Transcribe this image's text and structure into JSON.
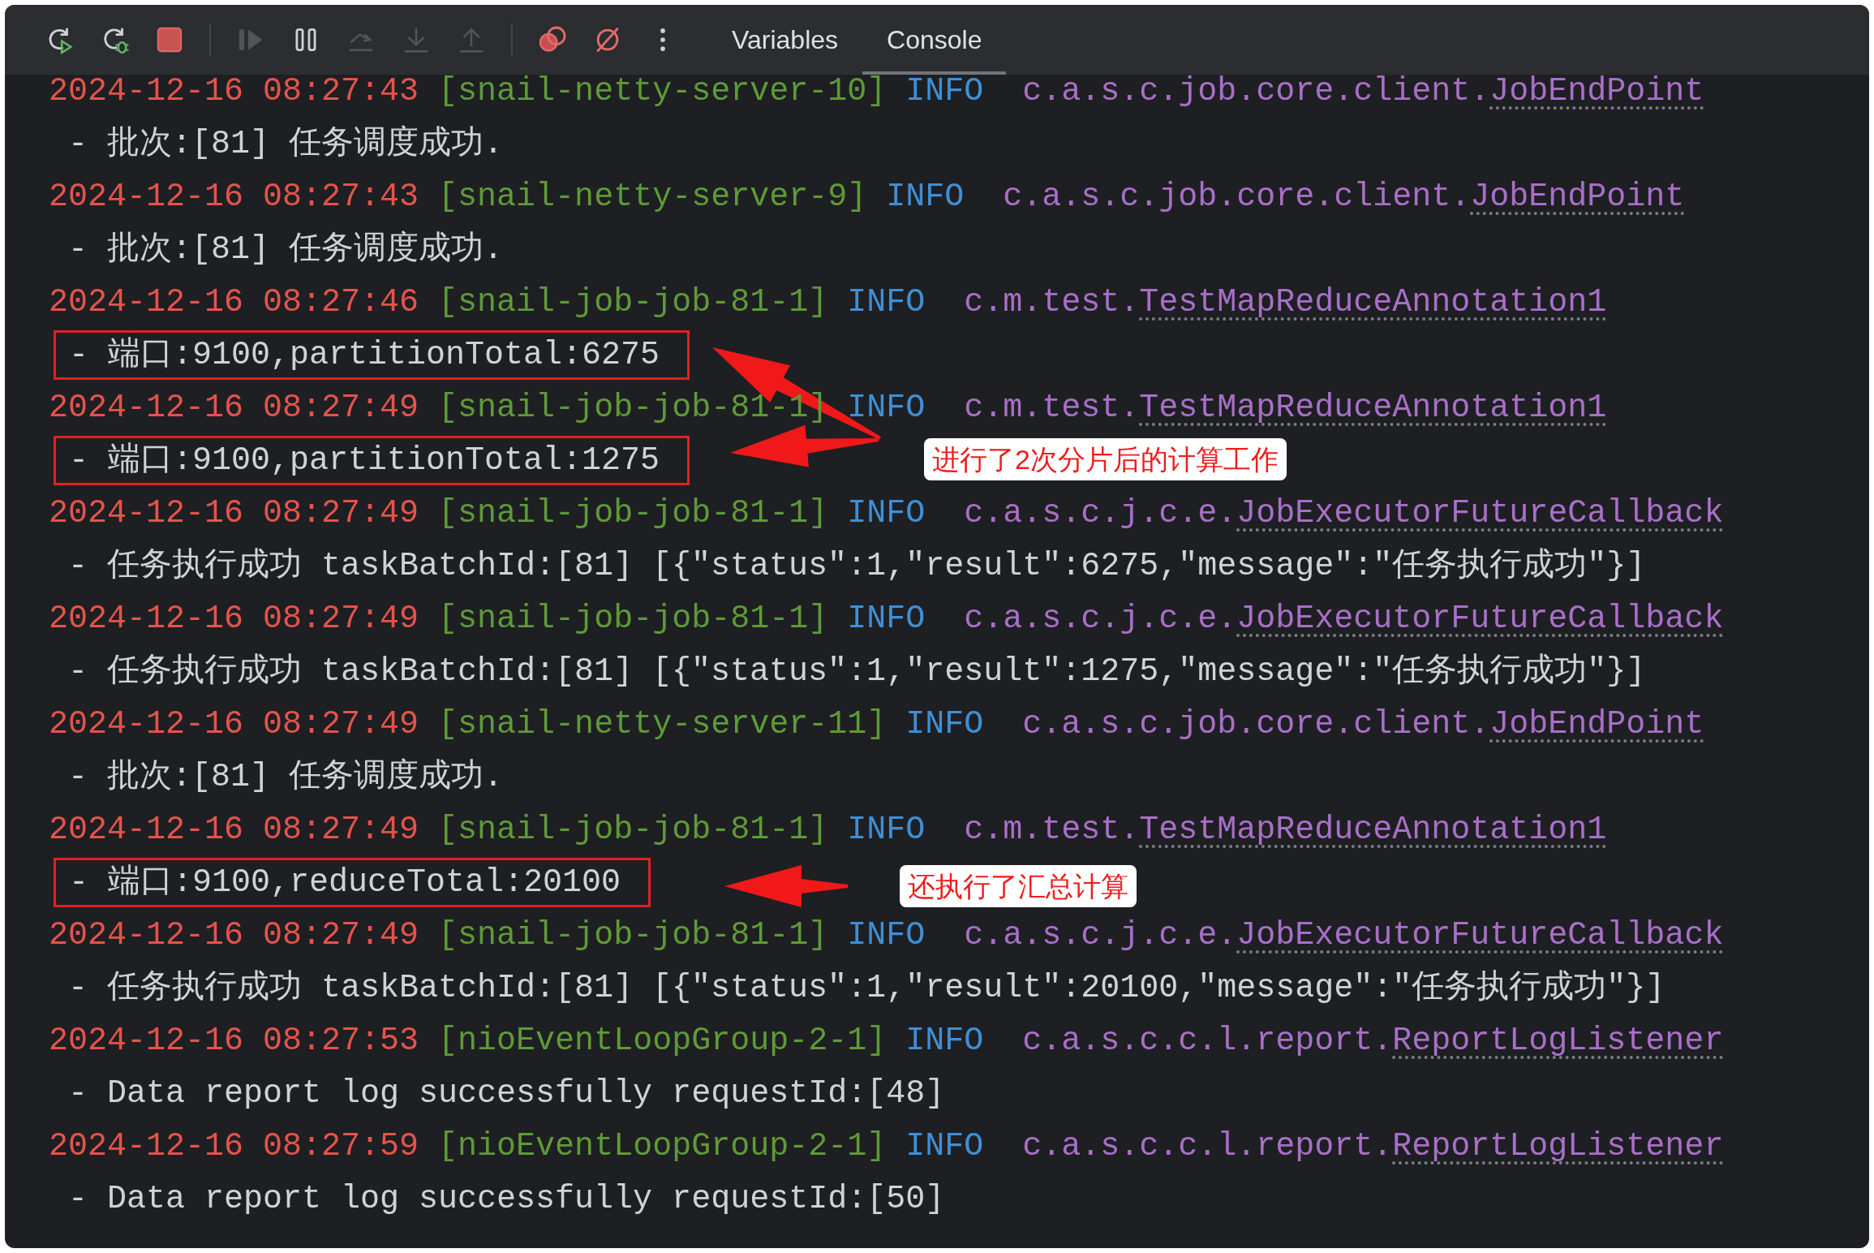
{
  "toolbar": {
    "buttons": [
      {
        "kind": "rerun",
        "disabled": false
      },
      {
        "kind": "rerun-debug",
        "disabled": false
      },
      {
        "kind": "stop",
        "disabled": false
      },
      {
        "kind": "resume",
        "disabled": true
      },
      {
        "kind": "pause",
        "disabled": false
      },
      {
        "kind": "step-over",
        "disabled": true
      },
      {
        "kind": "step-into",
        "disabled": true
      },
      {
        "kind": "step-out",
        "disabled": true
      },
      {
        "kind": "breakpoints",
        "disabled": false
      },
      {
        "kind": "mute-breakpoints",
        "disabled": false
      },
      {
        "kind": "more",
        "disabled": false
      }
    ],
    "tabs": [
      {
        "label": "Variables",
        "selected": false
      },
      {
        "label": "Console",
        "selected": true
      }
    ]
  },
  "console": {
    "entries": [
      {
        "timestamp": "2024-12-16 08:27:43",
        "thread": "[snail-netty-server-10]",
        "level": "INFO",
        "logger_package": "c.a.s.c.job.core.client.",
        "logger_class": "JobEndPoint",
        "message": "- 批次:[81] 任务调度成功.",
        "boxed": false
      },
      {
        "timestamp": "2024-12-16 08:27:43",
        "thread": "[snail-netty-server-9]",
        "level": "INFO",
        "logger_package": "c.a.s.c.job.core.client.",
        "logger_class": "JobEndPoint",
        "message": "- 批次:[81] 任务调度成功.",
        "boxed": false
      },
      {
        "timestamp": "2024-12-16 08:27:46",
        "thread": "[snail-job-job-81-1]",
        "level": "INFO",
        "logger_package": "c.m.test.",
        "logger_class": "TestMapReduceAnnotation1",
        "message": "- 端口:9100,partitionTotal:6275",
        "boxed": true
      },
      {
        "timestamp": "2024-12-16 08:27:49",
        "thread": "[snail-job-job-81-1]",
        "level": "INFO",
        "logger_package": "c.m.test.",
        "logger_class": "TestMapReduceAnnotation1",
        "message": "- 端口:9100,partitionTotal:1275",
        "boxed": true
      },
      {
        "timestamp": "2024-12-16 08:27:49",
        "thread": "[snail-job-job-81-1]",
        "level": "INFO",
        "logger_package": "c.a.s.c.j.c.e.",
        "logger_class": "JobExecutorFutureCallback",
        "message": "- 任务执行成功 taskBatchId:[81] [{\"status\":1,\"result\":6275,\"message\":\"任务执行成功\"}]",
        "boxed": false
      },
      {
        "timestamp": "2024-12-16 08:27:49",
        "thread": "[snail-job-job-81-1]",
        "level": "INFO",
        "logger_package": "c.a.s.c.j.c.e.",
        "logger_class": "JobExecutorFutureCallback",
        "message": "- 任务执行成功 taskBatchId:[81] [{\"status\":1,\"result\":1275,\"message\":\"任务执行成功\"}]",
        "boxed": false
      },
      {
        "timestamp": "2024-12-16 08:27:49",
        "thread": "[snail-netty-server-11]",
        "level": "INFO",
        "logger_package": "c.a.s.c.job.core.client.",
        "logger_class": "JobEndPoint",
        "message": "- 批次:[81] 任务调度成功.",
        "boxed": false
      },
      {
        "timestamp": "2024-12-16 08:27:49",
        "thread": "[snail-job-job-81-1]",
        "level": "INFO",
        "logger_package": "c.m.test.",
        "logger_class": "TestMapReduceAnnotation1",
        "message": "- 端口:9100,reduceTotal:20100",
        "boxed": true
      },
      {
        "timestamp": "2024-12-16 08:27:49",
        "thread": "[snail-job-job-81-1]",
        "level": "INFO",
        "logger_package": "c.a.s.c.j.c.e.",
        "logger_class": "JobExecutorFutureCallback",
        "message": "- 任务执行成功 taskBatchId:[81] [{\"status\":1,\"result\":20100,\"message\":\"任务执行成功\"}]",
        "boxed": false
      },
      {
        "timestamp": "2024-12-16 08:27:53",
        "thread": "[nioEventLoopGroup-2-1]",
        "level": "INFO",
        "logger_package": "c.a.s.c.c.l.report.",
        "logger_class": "ReportLogListener",
        "message": "- Data report log successfully requestId:[48]",
        "boxed": false
      },
      {
        "timestamp": "2024-12-16 08:27:59",
        "thread": "[nioEventLoopGroup-2-1]",
        "level": "INFO",
        "logger_package": "c.a.s.c.c.l.report.",
        "logger_class": "ReportLogListener",
        "message": "- Data report log successfully requestId:[50]",
        "boxed": false
      }
    ]
  },
  "callouts": [
    {
      "label": "进行了2次分片后的计算工作"
    },
    {
      "label": "还执行了汇总计算"
    }
  ]
}
